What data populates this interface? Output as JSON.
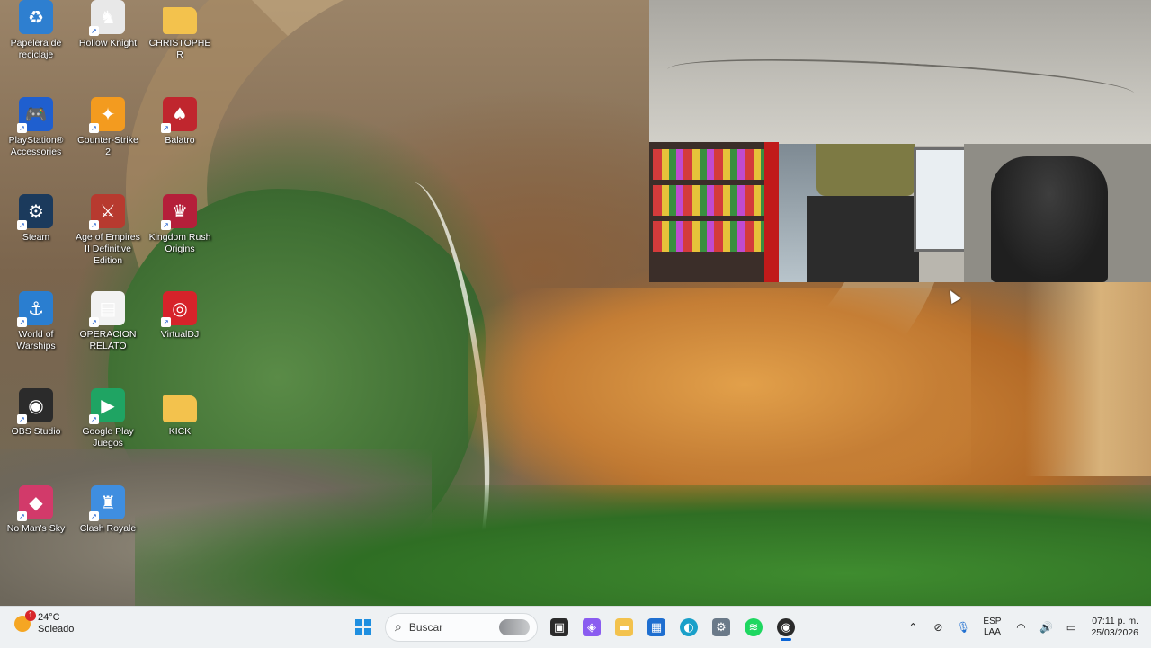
{
  "desktop": {
    "icons": [
      {
        "label": "Papelera de reciclaje",
        "icon": "recycle-bin-icon",
        "color": "#2e7fd0"
      },
      {
        "label": "Hollow Knight",
        "icon": "hollow-knight-icon",
        "color": "#e8e8e8"
      },
      {
        "label": "CHRISTOPHER",
        "icon": "folder-icon",
        "color": "#f3c24d"
      },
      {
        "label": "PlayStation® Accessories",
        "icon": "playstation-accessories-icon",
        "color": "#1f5fcf"
      },
      {
        "label": "Counter-Strike 2",
        "icon": "counter-strike-icon",
        "color": "#f39b1f"
      },
      {
        "label": "Balatro",
        "icon": "balatro-icon",
        "color": "#c0262e"
      },
      {
        "label": "Steam",
        "icon": "steam-icon",
        "color": "#1b3a5c"
      },
      {
        "label": "Age of Empires II Definitive Edition",
        "icon": "age-of-empires-icon",
        "color": "#b73a2f"
      },
      {
        "label": "Kingdom Rush Origins",
        "icon": "kingdom-rush-icon",
        "color": "#b51f3a"
      },
      {
        "label": "World of Warships",
        "icon": "world-of-warships-icon",
        "color": "#2a7ed0"
      },
      {
        "label": "OPERACION RELATO",
        "icon": "document-icon",
        "color": "#f2f2f2"
      },
      {
        "label": "VirtualDJ",
        "icon": "virtualdj-icon",
        "color": "#d6232a"
      },
      {
        "label": "OBS Studio",
        "icon": "obs-studio-icon",
        "color": "#2b2b2b"
      },
      {
        "label": "Google Play Juegos",
        "icon": "google-play-games-icon",
        "color": "#1fa463"
      },
      {
        "label": "KICK",
        "icon": "folder-icon",
        "color": "#f3c24d"
      },
      {
        "label": "No Man's Sky",
        "icon": "no-mans-sky-icon",
        "color": "#d23a6a"
      },
      {
        "label": "Clash Royale",
        "icon": "clash-royale-icon",
        "color": "#3f8ee0"
      }
    ]
  },
  "taskbar": {
    "weather": {
      "temperature": "24°C",
      "condition": "Soleado",
      "badge": "1"
    },
    "search": {
      "placeholder": "Buscar"
    },
    "apps": [
      {
        "name": "task-view",
        "icon": "task-view-icon",
        "color": "#2b2b2b"
      },
      {
        "name": "copilot",
        "icon": "copilot-icon",
        "color": "#8a5cf0"
      },
      {
        "name": "file-explorer",
        "icon": "file-explorer-icon",
        "color": "#f3c24d"
      },
      {
        "name": "microsoft-store",
        "icon": "store-icon",
        "color": "#1f6fd0"
      },
      {
        "name": "edge",
        "icon": "edge-icon",
        "color": "#1aa0c9"
      },
      {
        "name": "settings",
        "icon": "settings-gear-icon",
        "color": "#6b7a89"
      },
      {
        "name": "spotify",
        "icon": "spotify-icon",
        "color": "#1ed760"
      },
      {
        "name": "obs",
        "icon": "obs-icon",
        "color": "#2b2b2b"
      }
    ],
    "tray": {
      "language": {
        "line1": "ESP",
        "line2": "LAA"
      },
      "clock": {
        "time": "07:11 p. m.",
        "date": "25/03/2026"
      }
    }
  }
}
